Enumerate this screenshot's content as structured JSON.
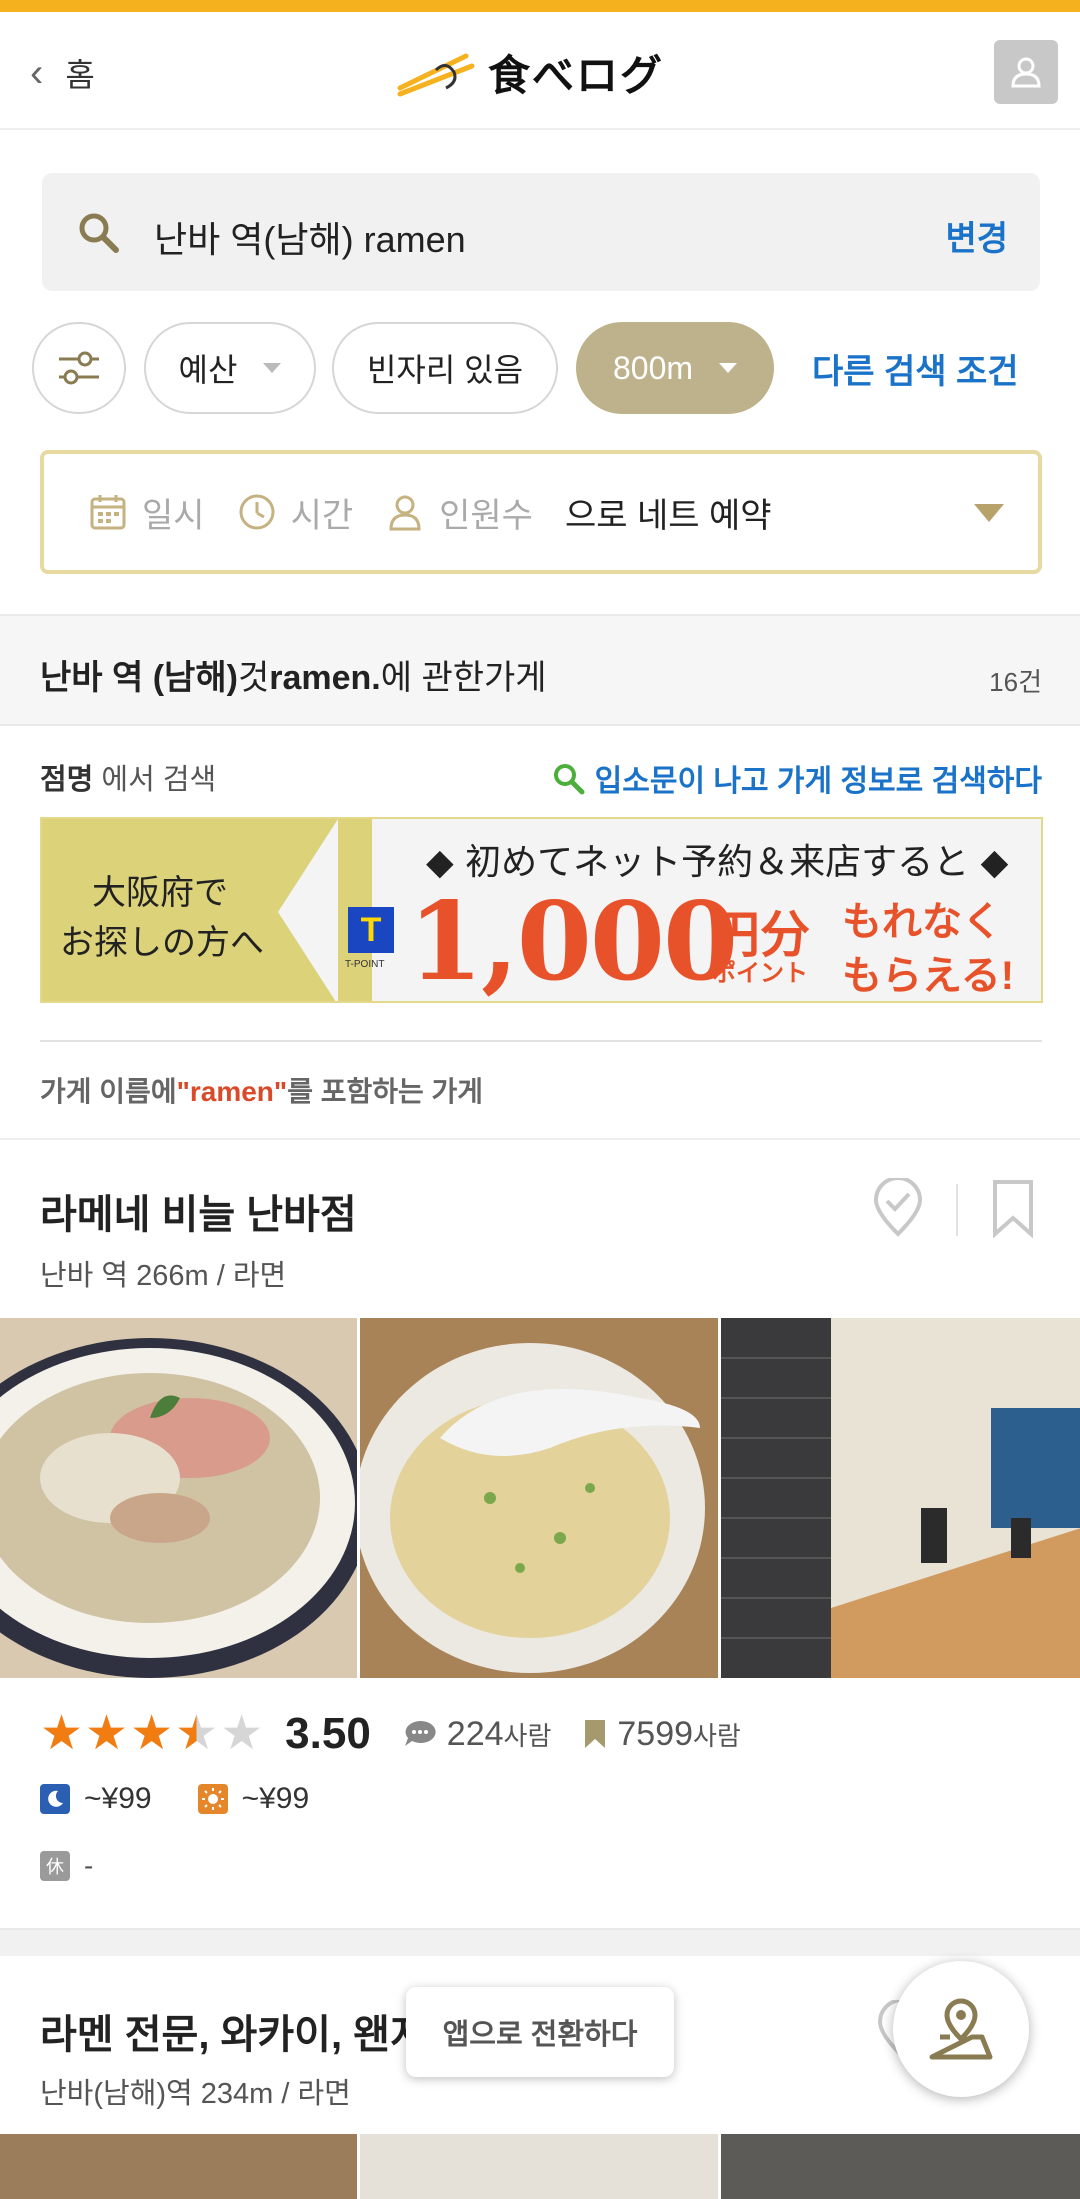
{
  "header": {
    "back_label": "홈",
    "logo_text": "食べログ"
  },
  "search": {
    "query": "난바 역(남해) ramen",
    "change_label": "변경"
  },
  "filters": {
    "budget_label": "예산",
    "vacancy_label": "빈자리 있음",
    "distance_label": "800m",
    "other_conditions_label": "다른 검색 조건"
  },
  "reservation": {
    "date_label": "일시",
    "time_label": "시간",
    "people_label": "인원수",
    "suffix_label": "으로 네트 예약"
  },
  "results": {
    "station": "난바 역 (남해)",
    "connector": "것",
    "keyword": "ramen.",
    "tail": "에 관한가게",
    "count": "16건"
  },
  "search_options": {
    "shop_name_bold": "점명",
    "shop_name_rest": " 에서 검색",
    "info_search": "입소문이 나고 가게 정보로 검색하다"
  },
  "banner": {
    "left_line1": "大阪府で",
    "left_line2": "お探しの方へ",
    "top_text": "◆ 初めてネット予約＆来店すると ◆",
    "tpoint_letter": "T",
    "tpoint_label": "T-POINT",
    "amount": "1,000",
    "unit": "円分",
    "points": "ポイント",
    "right_line1": "もれなく",
    "right_line2": "もらえる!"
  },
  "name_filter": {
    "prefix": "가게 이름에",
    "keyword": "\"ramen\"",
    "suffix": "를 포함하는 가게"
  },
  "restaurants": [
    {
      "name": "라메네 비늘 난바점",
      "subtitle": "난바 역 266m / 라면",
      "rating": 3.5,
      "rating_text": "3.50",
      "reviews_count": "224",
      "reviews_unit": "사람",
      "saves_count": "7599",
      "saves_unit": "사람",
      "dinner_price": "~¥99",
      "lunch_price": "~¥99",
      "closed_label": "休",
      "closed_value": "-"
    },
    {
      "name": "라멘 전문, 와카이, 왠지",
      "subtitle": "난바(남해)역 234m / 라면"
    }
  ],
  "app_switch_label": "앱으로 전환하다",
  "colors": {
    "accent_top": "#f5b21e",
    "link_blue": "#1a73c9",
    "star_orange": "#f07c12",
    "selected_chip": "#bdb28c",
    "highlight_red": "#d84a28"
  }
}
